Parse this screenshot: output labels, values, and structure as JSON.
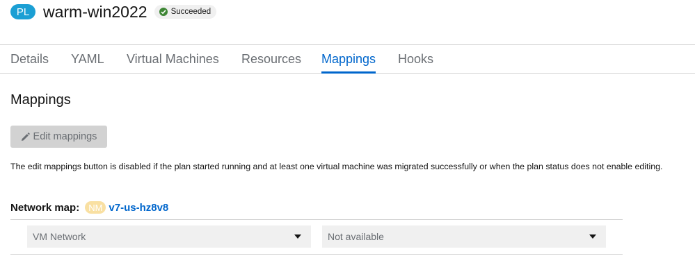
{
  "header": {
    "badge": "PL",
    "title": "warm-win2022",
    "status": "Succeeded"
  },
  "tabs": [
    {
      "label": "Details"
    },
    {
      "label": "YAML"
    },
    {
      "label": "Virtual Machines"
    },
    {
      "label": "Resources"
    },
    {
      "label": "Mappings",
      "active": true
    },
    {
      "label": "Hooks"
    }
  ],
  "section": {
    "title": "Mappings",
    "edit_button": "Edit mappings",
    "helper_text": "The edit mappings button is disabled if the plan started running and at least one virtual machine was migrated successfully or when the plan status does not enable editing."
  },
  "network_map": {
    "label": "Network map:",
    "badge": "NM",
    "name": "v7-us-hz8v8",
    "rows": [
      {
        "source": "VM Network",
        "target": "Not available"
      }
    ]
  },
  "colors": {
    "accent": "#0066cc",
    "pl_badge": "#1b9fd4",
    "nm_badge": "#f9e0a2",
    "success": "#3e8635"
  }
}
